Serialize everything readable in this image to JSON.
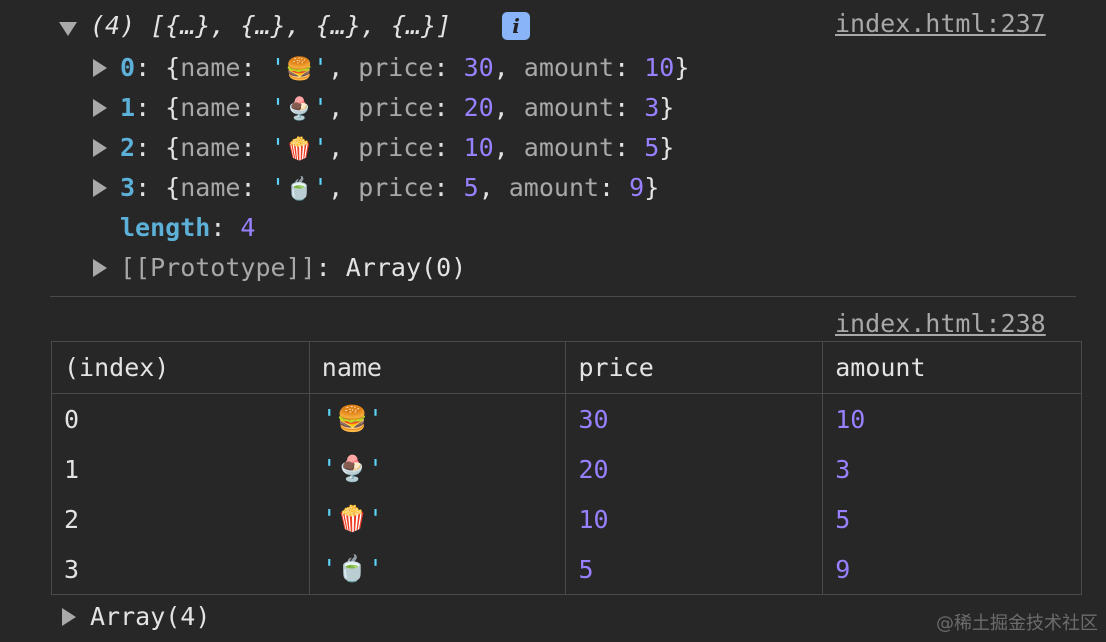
{
  "log1": {
    "summary_count": "(4)",
    "summary_preview": "[{…}, {…}, {…}, {…}]",
    "info_badge": "i",
    "source": "index.html:237",
    "items": [
      {
        "index": "0",
        "name": "🍔",
        "price": "30",
        "amount": "10"
      },
      {
        "index": "1",
        "name": "🍨",
        "price": "20",
        "amount": "3"
      },
      {
        "index": "2",
        "name": "🍿",
        "price": "10",
        "amount": "5"
      },
      {
        "index": "3",
        "name": "🍵",
        "price": "5",
        "amount": "9"
      }
    ],
    "key_name": "name",
    "key_price": "price",
    "key_amount": "amount",
    "length_key": "length",
    "length_value": "4",
    "prototype_key": "[[Prototype]]",
    "prototype_value": "Array(0)"
  },
  "log2": {
    "source": "index.html:238",
    "columns": [
      "(index)",
      "name",
      "price",
      "amount"
    ],
    "rows": [
      {
        "index": "0",
        "name": "'🍔'",
        "price": "30",
        "amount": "10"
      },
      {
        "index": "1",
        "name": "'🍨'",
        "price": "20",
        "amount": "3"
      },
      {
        "index": "2",
        "name": "'🍿'",
        "price": "10",
        "amount": "5"
      },
      {
        "index": "3",
        "name": "'🍵'",
        "price": "5",
        "amount": "9"
      }
    ],
    "footer": "Array(4)"
  },
  "watermark": "@稀土掘金技术社区",
  "colors": {
    "background": "#272727",
    "number": "#9980ff",
    "string": "#5cd5fb",
    "index_key": "#5db0d7",
    "key": "#a8a8a8"
  }
}
